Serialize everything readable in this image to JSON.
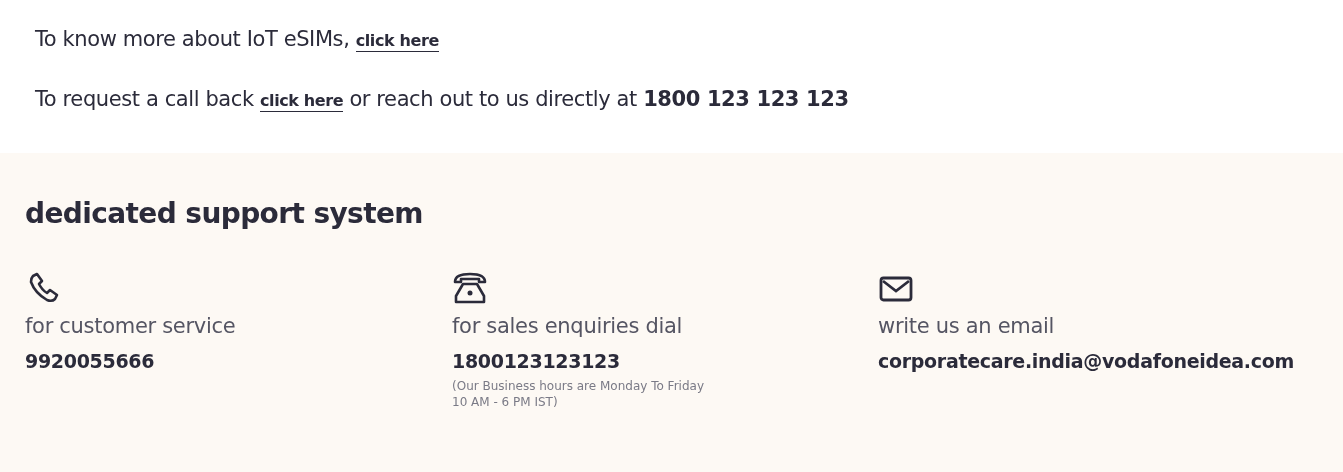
{
  "info_lines": [
    {
      "before": "To know more about IoT eSIMs, ",
      "link": "click here"
    },
    {
      "before": "To request a call back ",
      "link": "click here",
      "after": " or reach out to us directly at **1800 123 123 123**"
    }
  ],
  "support": {
    "title": "dedicated support system",
    "columns": [
      {
        "kind": "phone",
        "label": "for customer service",
        "value": "9920055666"
      },
      {
        "kind": "telephone",
        "label": "for sales enquiries dial",
        "value": "1800123123123",
        "note": "(Our Business hours are Monday To Friday 10 AM - 6 PM IST)"
      },
      {
        "kind": "mail",
        "label": "write us an email",
        "value": "corporatecare.india@vodafoneidea.com"
      }
    ]
  }
}
